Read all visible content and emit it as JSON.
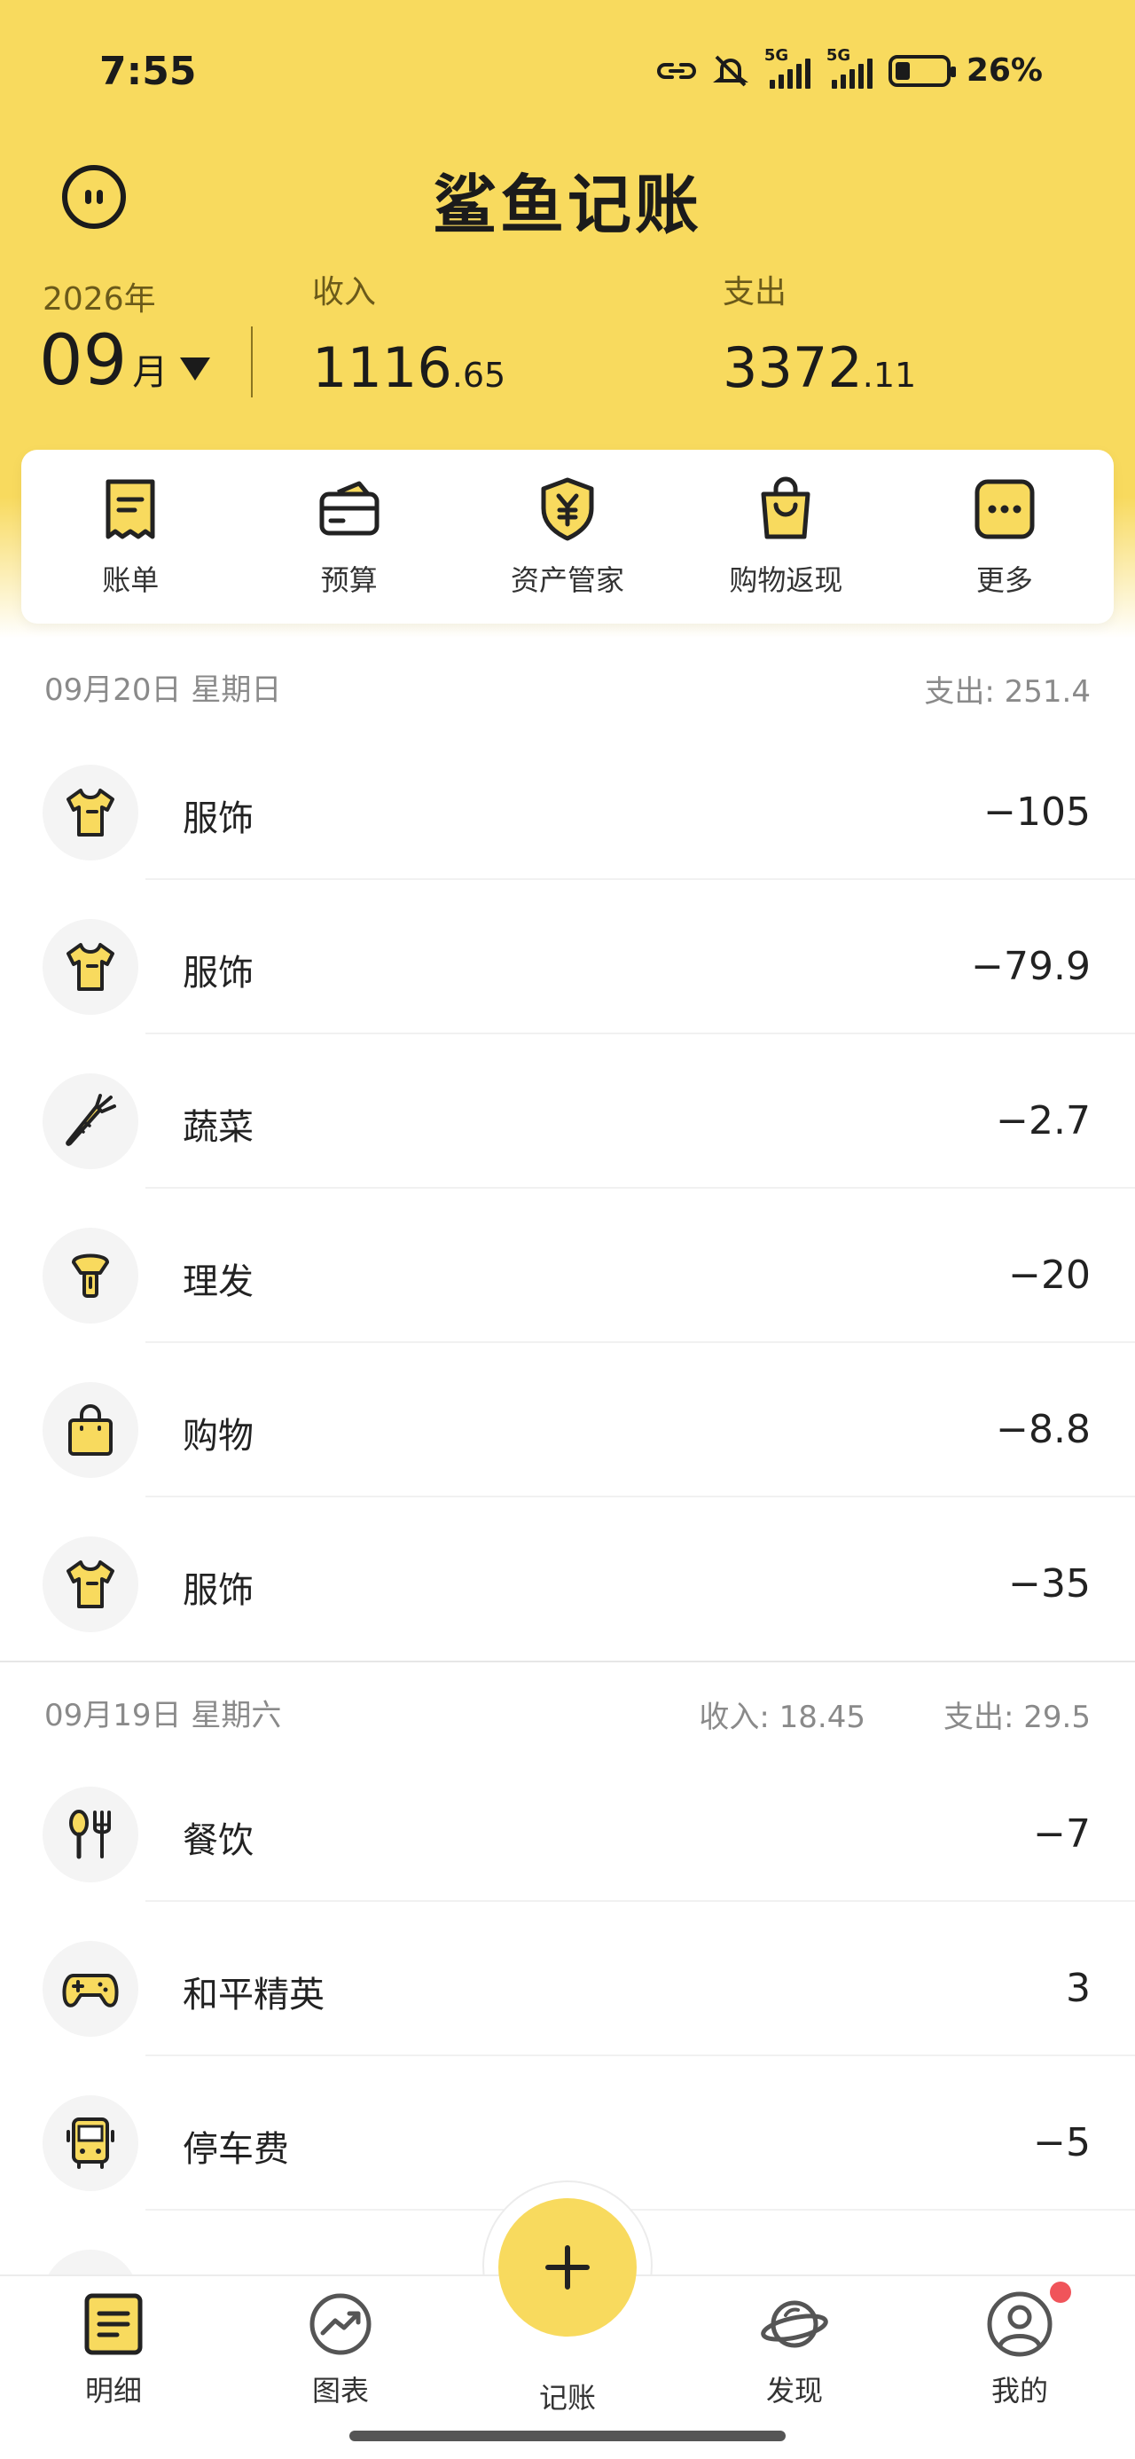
{
  "status_bar": {
    "time": "7:55",
    "network_1": "5G",
    "network_2": "5G",
    "battery": "26%"
  },
  "app": {
    "title": "鲨鱼记账"
  },
  "period": {
    "year": "2026年",
    "month": "09",
    "month_unit": "月"
  },
  "summary": {
    "income_label": "收入",
    "income_int": "1116",
    "income_dec": ".65",
    "expense_label": "支出",
    "expense_int": "3372",
    "expense_dec": ".11"
  },
  "quick_menu": [
    {
      "label": "账单",
      "icon": "bill-icon"
    },
    {
      "label": "预算",
      "icon": "wallet-icon"
    },
    {
      "label": "资产管家",
      "icon": "shield-yen-icon"
    },
    {
      "label": "购物返现",
      "icon": "shopping-bag-icon"
    },
    {
      "label": "更多",
      "icon": "more-icon"
    }
  ],
  "days": [
    {
      "date": "09月20日 星期日",
      "expense_label": "支出:",
      "expense": "251.4",
      "items": [
        {
          "category": "服饰",
          "amount": "−105",
          "icon": "tshirt-icon"
        },
        {
          "category": "服饰",
          "amount": "−79.9",
          "icon": "tshirt-icon"
        },
        {
          "category": "蔬菜",
          "amount": "−2.7",
          "icon": "carrot-icon"
        },
        {
          "category": "理发",
          "amount": "−20",
          "icon": "hairdryer-icon"
        },
        {
          "category": "购物",
          "amount": "−8.8",
          "icon": "bag-icon"
        },
        {
          "category": "服饰",
          "amount": "−35",
          "icon": "tshirt-icon"
        }
      ]
    },
    {
      "date": "09月19日 星期六",
      "income_label": "收入:",
      "income": "18.45",
      "expense_label": "支出:",
      "expense": "29.5",
      "items": [
        {
          "category": "餐饮",
          "amount": "−7",
          "icon": "utensils-icon"
        },
        {
          "category": "和平精英",
          "amount": "3",
          "icon": "gamepad-icon"
        },
        {
          "category": "停车费",
          "amount": "−5",
          "icon": "bus-icon"
        }
      ]
    }
  ],
  "bottom_nav": [
    {
      "label": "明细",
      "icon": "detail-icon"
    },
    {
      "label": "图表",
      "icon": "chart-icon"
    },
    {
      "label": "记账",
      "icon": "plus-icon"
    },
    {
      "label": "发现",
      "icon": "planet-icon"
    },
    {
      "label": "我的",
      "icon": "profile-icon"
    }
  ],
  "colors": {
    "brand_yellow": "#f8da5e",
    "badge_red": "#f0545a"
  }
}
